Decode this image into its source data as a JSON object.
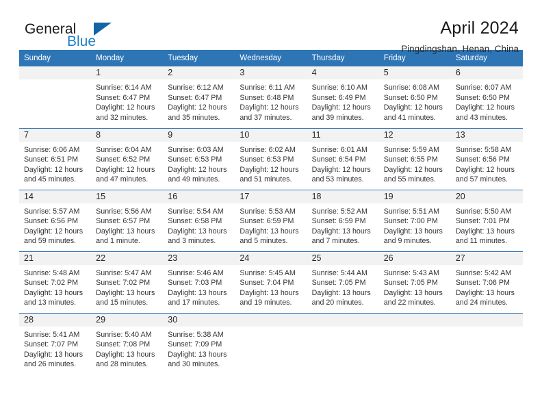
{
  "brand": {
    "name_part1": "General",
    "name_part2": "Blue",
    "triangle_color": "#1464a5",
    "blue_color": "#1f7fc4"
  },
  "header": {
    "title": "April 2024",
    "subtitle": "Pingdingshan, Henan, China",
    "header_bg_color": "#2e75b6",
    "daynum_band_color": "#f2f2f2"
  },
  "weekday_headers": [
    "Sunday",
    "Monday",
    "Tuesday",
    "Wednesday",
    "Thursday",
    "Friday",
    "Saturday"
  ],
  "labels": {
    "sunrise_prefix": "Sunrise:",
    "sunset_prefix": "Sunset:",
    "daylight_prefix": "Daylight:"
  },
  "weeks": [
    [
      {
        "day": "",
        "sunrise": "",
        "sunset": "",
        "daylight_l1": "",
        "daylight_l2": ""
      },
      {
        "day": "1",
        "sunrise": "Sunrise: 6:14 AM",
        "sunset": "Sunset: 6:47 PM",
        "daylight_l1": "Daylight: 12 hours",
        "daylight_l2": "and 32 minutes."
      },
      {
        "day": "2",
        "sunrise": "Sunrise: 6:12 AM",
        "sunset": "Sunset: 6:47 PM",
        "daylight_l1": "Daylight: 12 hours",
        "daylight_l2": "and 35 minutes."
      },
      {
        "day": "3",
        "sunrise": "Sunrise: 6:11 AM",
        "sunset": "Sunset: 6:48 PM",
        "daylight_l1": "Daylight: 12 hours",
        "daylight_l2": "and 37 minutes."
      },
      {
        "day": "4",
        "sunrise": "Sunrise: 6:10 AM",
        "sunset": "Sunset: 6:49 PM",
        "daylight_l1": "Daylight: 12 hours",
        "daylight_l2": "and 39 minutes."
      },
      {
        "day": "5",
        "sunrise": "Sunrise: 6:08 AM",
        "sunset": "Sunset: 6:50 PM",
        "daylight_l1": "Daylight: 12 hours",
        "daylight_l2": "and 41 minutes."
      },
      {
        "day": "6",
        "sunrise": "Sunrise: 6:07 AM",
        "sunset": "Sunset: 6:50 PM",
        "daylight_l1": "Daylight: 12 hours",
        "daylight_l2": "and 43 minutes."
      }
    ],
    [
      {
        "day": "7",
        "sunrise": "Sunrise: 6:06 AM",
        "sunset": "Sunset: 6:51 PM",
        "daylight_l1": "Daylight: 12 hours",
        "daylight_l2": "and 45 minutes."
      },
      {
        "day": "8",
        "sunrise": "Sunrise: 6:04 AM",
        "sunset": "Sunset: 6:52 PM",
        "daylight_l1": "Daylight: 12 hours",
        "daylight_l2": "and 47 minutes."
      },
      {
        "day": "9",
        "sunrise": "Sunrise: 6:03 AM",
        "sunset": "Sunset: 6:53 PM",
        "daylight_l1": "Daylight: 12 hours",
        "daylight_l2": "and 49 minutes."
      },
      {
        "day": "10",
        "sunrise": "Sunrise: 6:02 AM",
        "sunset": "Sunset: 6:53 PM",
        "daylight_l1": "Daylight: 12 hours",
        "daylight_l2": "and 51 minutes."
      },
      {
        "day": "11",
        "sunrise": "Sunrise: 6:01 AM",
        "sunset": "Sunset: 6:54 PM",
        "daylight_l1": "Daylight: 12 hours",
        "daylight_l2": "and 53 minutes."
      },
      {
        "day": "12",
        "sunrise": "Sunrise: 5:59 AM",
        "sunset": "Sunset: 6:55 PM",
        "daylight_l1": "Daylight: 12 hours",
        "daylight_l2": "and 55 minutes."
      },
      {
        "day": "13",
        "sunrise": "Sunrise: 5:58 AM",
        "sunset": "Sunset: 6:56 PM",
        "daylight_l1": "Daylight: 12 hours",
        "daylight_l2": "and 57 minutes."
      }
    ],
    [
      {
        "day": "14",
        "sunrise": "Sunrise: 5:57 AM",
        "sunset": "Sunset: 6:56 PM",
        "daylight_l1": "Daylight: 12 hours",
        "daylight_l2": "and 59 minutes."
      },
      {
        "day": "15",
        "sunrise": "Sunrise: 5:56 AM",
        "sunset": "Sunset: 6:57 PM",
        "daylight_l1": "Daylight: 13 hours",
        "daylight_l2": "and 1 minute."
      },
      {
        "day": "16",
        "sunrise": "Sunrise: 5:54 AM",
        "sunset": "Sunset: 6:58 PM",
        "daylight_l1": "Daylight: 13 hours",
        "daylight_l2": "and 3 minutes."
      },
      {
        "day": "17",
        "sunrise": "Sunrise: 5:53 AM",
        "sunset": "Sunset: 6:59 PM",
        "daylight_l1": "Daylight: 13 hours",
        "daylight_l2": "and 5 minutes."
      },
      {
        "day": "18",
        "sunrise": "Sunrise: 5:52 AM",
        "sunset": "Sunset: 6:59 PM",
        "daylight_l1": "Daylight: 13 hours",
        "daylight_l2": "and 7 minutes."
      },
      {
        "day": "19",
        "sunrise": "Sunrise: 5:51 AM",
        "sunset": "Sunset: 7:00 PM",
        "daylight_l1": "Daylight: 13 hours",
        "daylight_l2": "and 9 minutes."
      },
      {
        "day": "20",
        "sunrise": "Sunrise: 5:50 AM",
        "sunset": "Sunset: 7:01 PM",
        "daylight_l1": "Daylight: 13 hours",
        "daylight_l2": "and 11 minutes."
      }
    ],
    [
      {
        "day": "21",
        "sunrise": "Sunrise: 5:48 AM",
        "sunset": "Sunset: 7:02 PM",
        "daylight_l1": "Daylight: 13 hours",
        "daylight_l2": "and 13 minutes."
      },
      {
        "day": "22",
        "sunrise": "Sunrise: 5:47 AM",
        "sunset": "Sunset: 7:02 PM",
        "daylight_l1": "Daylight: 13 hours",
        "daylight_l2": "and 15 minutes."
      },
      {
        "day": "23",
        "sunrise": "Sunrise: 5:46 AM",
        "sunset": "Sunset: 7:03 PM",
        "daylight_l1": "Daylight: 13 hours",
        "daylight_l2": "and 17 minutes."
      },
      {
        "day": "24",
        "sunrise": "Sunrise: 5:45 AM",
        "sunset": "Sunset: 7:04 PM",
        "daylight_l1": "Daylight: 13 hours",
        "daylight_l2": "and 19 minutes."
      },
      {
        "day": "25",
        "sunrise": "Sunrise: 5:44 AM",
        "sunset": "Sunset: 7:05 PM",
        "daylight_l1": "Daylight: 13 hours",
        "daylight_l2": "and 20 minutes."
      },
      {
        "day": "26",
        "sunrise": "Sunrise: 5:43 AM",
        "sunset": "Sunset: 7:05 PM",
        "daylight_l1": "Daylight: 13 hours",
        "daylight_l2": "and 22 minutes."
      },
      {
        "day": "27",
        "sunrise": "Sunrise: 5:42 AM",
        "sunset": "Sunset: 7:06 PM",
        "daylight_l1": "Daylight: 13 hours",
        "daylight_l2": "and 24 minutes."
      }
    ],
    [
      {
        "day": "28",
        "sunrise": "Sunrise: 5:41 AM",
        "sunset": "Sunset: 7:07 PM",
        "daylight_l1": "Daylight: 13 hours",
        "daylight_l2": "and 26 minutes."
      },
      {
        "day": "29",
        "sunrise": "Sunrise: 5:40 AM",
        "sunset": "Sunset: 7:08 PM",
        "daylight_l1": "Daylight: 13 hours",
        "daylight_l2": "and 28 minutes."
      },
      {
        "day": "30",
        "sunrise": "Sunrise: 5:38 AM",
        "sunset": "Sunset: 7:09 PM",
        "daylight_l1": "Daylight: 13 hours",
        "daylight_l2": "and 30 minutes."
      },
      {
        "day": "",
        "sunrise": "",
        "sunset": "",
        "daylight_l1": "",
        "daylight_l2": ""
      },
      {
        "day": "",
        "sunrise": "",
        "sunset": "",
        "daylight_l1": "",
        "daylight_l2": ""
      },
      {
        "day": "",
        "sunrise": "",
        "sunset": "",
        "daylight_l1": "",
        "daylight_l2": ""
      },
      {
        "day": "",
        "sunrise": "",
        "sunset": "",
        "daylight_l1": "",
        "daylight_l2": ""
      }
    ]
  ]
}
